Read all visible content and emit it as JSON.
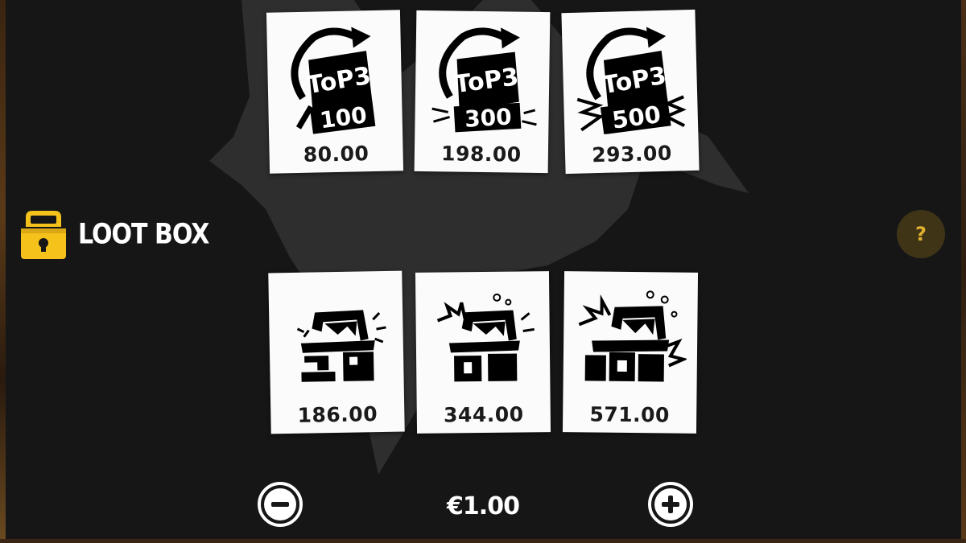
{
  "background_color": "#161616",
  "accent_color": "#f5c21b",
  "buy_options": [
    {
      "icon": "top3-100-icon",
      "badge_top": "ToP3",
      "badge_bottom": "100",
      "price": "80.00"
    },
    {
      "icon": "top3-300-icon",
      "badge_top": "ToP3",
      "badge_bottom": "300",
      "price": "198.00"
    },
    {
      "icon": "top3-500-icon",
      "badge_top": "ToP3",
      "badge_bottom": "500",
      "price": "293.00"
    },
    {
      "icon": "loot-chest-small-icon",
      "price": "186.00"
    },
    {
      "icon": "loot-chest-medium-icon",
      "price": "344.00"
    },
    {
      "icon": "loot-chest-large-icon",
      "price": "571.00"
    }
  ],
  "loot_box": {
    "label": "LOOT BOX",
    "icon": "treasure-chest-icon"
  },
  "help": {
    "label": "?",
    "icon": "help-icon"
  },
  "bet": {
    "value": "€1.00",
    "decrease_icon": "minus-icon",
    "increase_icon": "plus-icon"
  }
}
